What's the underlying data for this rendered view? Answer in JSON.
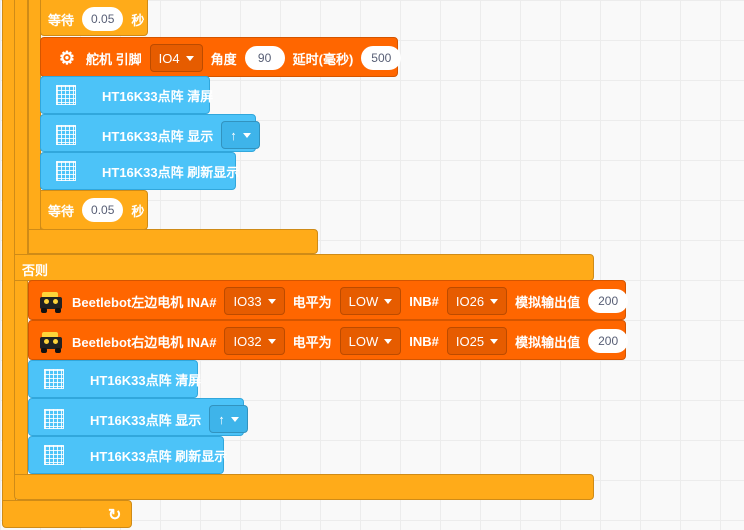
{
  "wait1": {
    "label": "等待",
    "value": "0.05",
    "unit": "秒"
  },
  "servo": {
    "icon": "servo-icon",
    "prefix": "舵机 引脚",
    "pin": "IO4",
    "angle_label": "角度",
    "angle": "90",
    "delay_label": "延时(毫秒)",
    "delay": "500"
  },
  "ht1": {
    "clear": "HT16K33点阵 清屏",
    "show": "HT16K33点阵 显示",
    "show_value": "↑",
    "refresh": "HT16K33点阵 刷新显示"
  },
  "wait2": {
    "label": "等待",
    "value": "0.05",
    "unit": "秒"
  },
  "else_label": "否则",
  "motor_left": {
    "label": "Beetlebot左边电机 INA#",
    "ina": "IO33",
    "level_label": "电平为",
    "level": "LOW",
    "inb_label": "INB#",
    "inb": "IO26",
    "analog_label": "模拟输出值",
    "analog": "200"
  },
  "motor_right": {
    "label": "Beetlebot右边电机 INA#",
    "ina": "IO32",
    "level_label": "电平为",
    "level": "LOW",
    "inb_label": "INB#",
    "inb": "IO25",
    "analog_label": "模拟输出值",
    "analog": "200"
  },
  "ht2": {
    "clear": "HT16K33点阵 清屏",
    "show": "HT16K33点阵 显示",
    "show_value": "↑",
    "refresh": "HT16K33点阵 刷新显示"
  },
  "loop_icon": "↻",
  "colors": {
    "control": "#ffab19",
    "servo_motor": "#ff6600",
    "matrix": "#4cc3f8"
  }
}
